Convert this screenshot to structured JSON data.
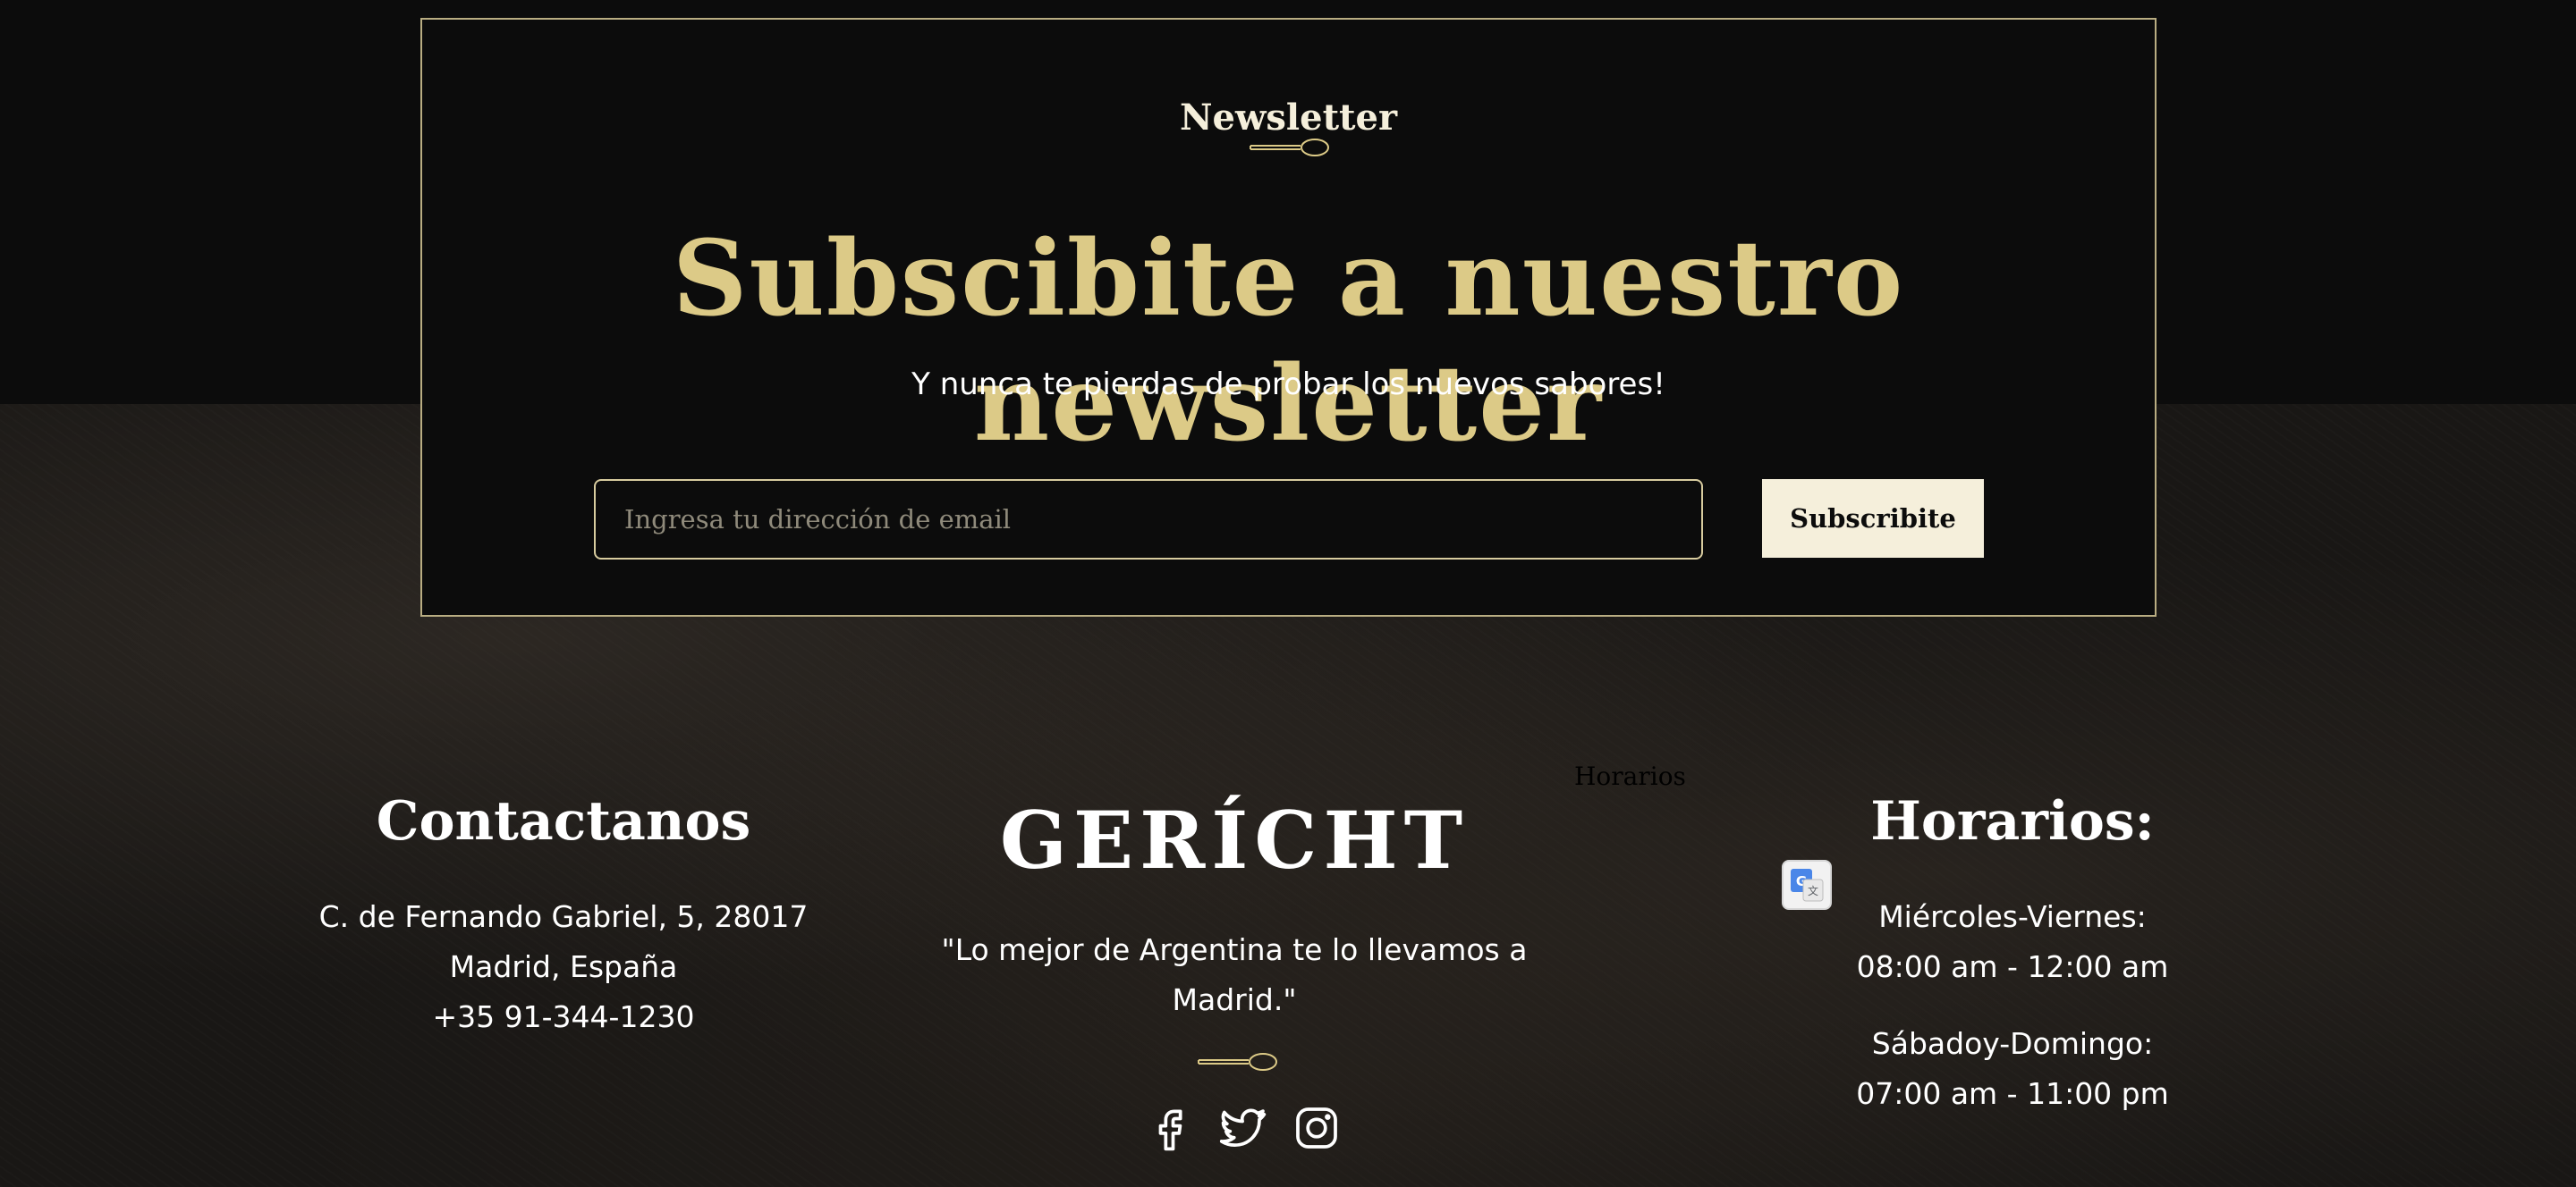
{
  "newsletter": {
    "subtitle": "Newsletter",
    "headline": "Subscibite a nuestro newsletter",
    "tagline": "Y nunca te pierdas de probar los nuevos sabores!",
    "email_placeholder": "Ingresa tu dirección de email",
    "email_value": "",
    "subscribe_label": "Subscribite"
  },
  "footer": {
    "contact": {
      "title": "Contactanos",
      "address": "C. de Fernando Gabriel, 5, 28017 Madrid, España",
      "phone": "+35 91-344-1230"
    },
    "brand": {
      "logo": "GERÍCHT",
      "quote": "\"Lo mejor de Argentina te lo llevamos a Madrid.\"",
      "social": [
        "facebook-icon",
        "twitter-icon",
        "instagram-icon"
      ]
    },
    "stray_label": "Horarios",
    "hours": {
      "title": "Horarios:",
      "entries": [
        {
          "days": "Miércoles-Viernes:",
          "time": "08:00 am - 12:00 am"
        },
        {
          "days": "Sábadoy-Domingo:",
          "time": "07:00 am - 11:00 pm"
        }
      ]
    }
  },
  "colors": {
    "background": "#0c0c0c",
    "gold": "#dcca87",
    "cream": "#f5efdb",
    "border_gold": "#b9ad82",
    "text": "#ffffff"
  }
}
